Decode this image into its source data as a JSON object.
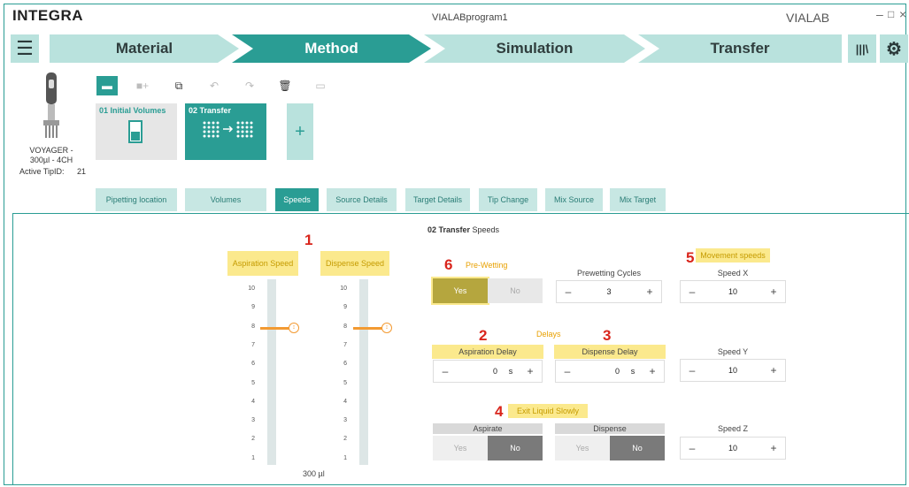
{
  "app": {
    "logo": "INTEGRA",
    "window_title": "VIALABprogram1",
    "brand": "VIALAB",
    "win_min": "–",
    "win_max": "□",
    "win_close": "×"
  },
  "nav": {
    "menu_icon": "☰",
    "steps": [
      "Material",
      "Method",
      "Simulation",
      "Transfer"
    ],
    "library_icon": "|||\\",
    "settings_icon": "⚙"
  },
  "pipette": {
    "model": "VOYAGER - 300µl - 4CH",
    "active_tip_label": "Active TipID:",
    "active_tip_value": "21"
  },
  "cards": [
    {
      "title": "01 Initial Volumes"
    },
    {
      "title": "02 Transfer"
    }
  ],
  "add_label": "+",
  "tabs": [
    "Pipetting location",
    "Volumes",
    "Speeds",
    "Source Details",
    "Target Details",
    "Tip Change",
    "Mix Source",
    "Mix Target"
  ],
  "panel": {
    "title_bold": "02 Transfer",
    "title_rest": " Speeds",
    "markers": {
      "m1": "1",
      "m2": "2",
      "m3": "3",
      "m4": "4",
      "m5": "5",
      "m6": "6"
    },
    "aspiration_speed_label": "Aspiration Speed",
    "dispense_speed_label": "Dispense Speed",
    "scale": [
      "10",
      "9",
      "8",
      "7",
      "6",
      "5",
      "4",
      "3",
      "2",
      "1"
    ],
    "aspiration_speed_value": 8,
    "dispense_speed_value": 8,
    "volume_label": "300 µl",
    "prewetting": {
      "label": "Pre-Wetting",
      "yes": "Yes",
      "no": "No",
      "cycles_label": "Prewetting Cycles",
      "cycles_value": "3"
    },
    "delays": {
      "label": "Delays",
      "aspiration_label": "Aspiration Delay",
      "aspiration_value": "0",
      "dispense_label": "Dispense Delay",
      "dispense_value": "0",
      "unit": "s"
    },
    "exit": {
      "label": "Exit Liquid Slowly",
      "aspirate_label": "Aspirate",
      "dispense_label": "Dispense",
      "yes": "Yes",
      "no": "No"
    },
    "movement": {
      "label": "Movement speeds",
      "x_label": "Speed X",
      "x_value": "10",
      "y_label": "Speed Y",
      "y_value": "10",
      "z_label": "Speed Z",
      "z_value": "10"
    },
    "minus": "–",
    "plus": "+"
  },
  "colors": {
    "teal": "#2a9d94",
    "light_teal": "#b9e2dd",
    "highlight": "#fbe98d",
    "marker_red": "#d9251c",
    "slider_orange": "#f39a32",
    "olive_selected": "#b5a63e",
    "dark_selected": "#7a7a7a"
  }
}
